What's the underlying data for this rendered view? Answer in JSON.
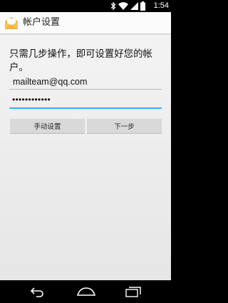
{
  "status_bar": {
    "time": "1:54",
    "icons": [
      "bluetooth-icon",
      "wifi-icon",
      "signal-icon",
      "battery-icon"
    ]
  },
  "action_bar": {
    "title": "帐户设置",
    "app_icon": "email-app-icon"
  },
  "form": {
    "instructions": "只需几步操作，即可设置好您的帐户。",
    "email_value": "mailteam@qq.com",
    "password_masked": "••••••••••••"
  },
  "buttons": {
    "manual_setup": "手动设置",
    "next": "下一步"
  },
  "nav_bar": {
    "icons": [
      "back-icon",
      "home-icon",
      "recents-icon"
    ]
  },
  "colors": {
    "accent": "#33b5e5",
    "status_bar": "#000000",
    "content_bg": "#f3f3f3",
    "button_bg": "#d9d9d9"
  }
}
